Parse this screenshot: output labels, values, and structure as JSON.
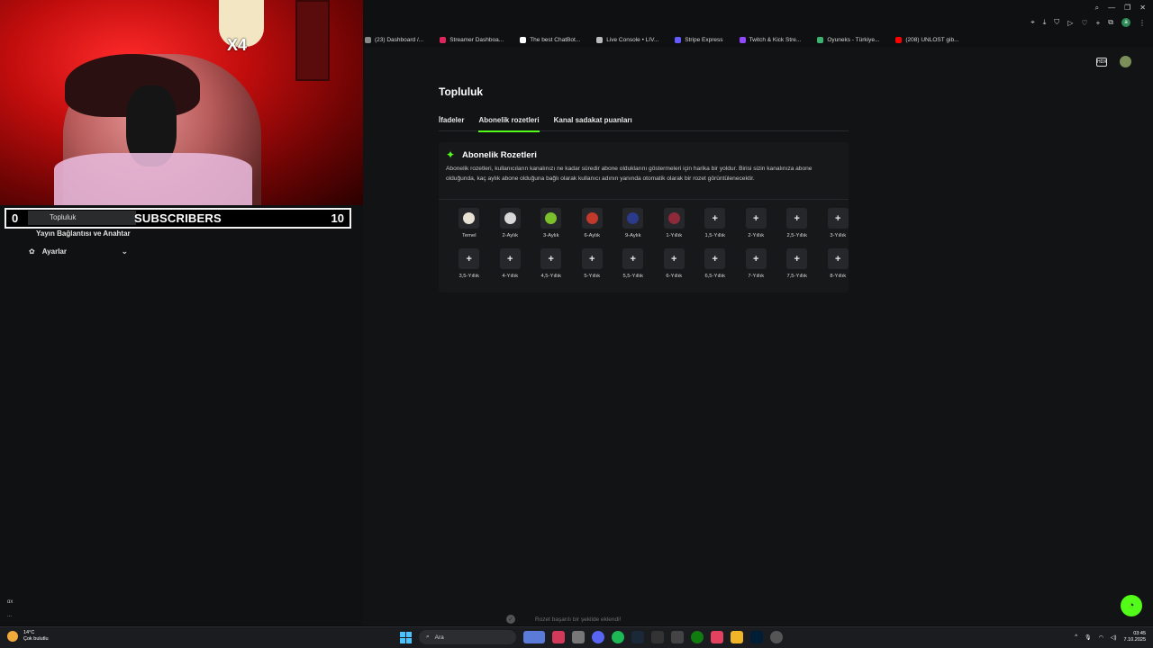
{
  "bookmarks": [
    {
      "label": "(23) Dashboard /...",
      "color": "#888888"
    },
    {
      "label": "Streamer Dashboa...",
      "color": "#e0245e"
    },
    {
      "label": "The best ChatBot...",
      "color": "#ffffff"
    },
    {
      "label": "Live Console • LIV...",
      "color": "#bbbbbb"
    },
    {
      "label": "Stripe Express",
      "color": "#635bff"
    },
    {
      "label": "Twitch & Kick Stre...",
      "color": "#9146ff"
    },
    {
      "label": "Oyuneks - Türkiye...",
      "color": "#3cb371"
    },
    {
      "label": "(208) UNLOST gib...",
      "color": "#ff0000"
    }
  ],
  "sidebar": {
    "stream_key_label": "Yayın Bağlantısı ve Anahtar",
    "settings_label": "Ayarlar",
    "bottom_1": "ɑx",
    "bottom_2": "..."
  },
  "overlay": {
    "chibi_text": "X4",
    "goal_start": "0",
    "goal_label": "SUBSCRIBERS",
    "goal_end": "10",
    "hidden_nav_item": "Topluluk"
  },
  "page": {
    "title": "Topluluk",
    "tabs": [
      {
        "label": "İfadeler",
        "active": false
      },
      {
        "label": "Abonelik rozetleri",
        "active": true
      },
      {
        "label": "Kanal sadakat puanları",
        "active": false
      }
    ]
  },
  "card": {
    "title": "Abonelik Rozetleri",
    "description": "Abonelik rozetleri, kullanıcıların kanalınızı ne kadar süredir abone olduklarını göstermeleri için harika bir yoldur. Birisi sizin kanalınıza abone olduğunda, kaç aylık abone olduğuna bağlı olarak kullanıcı adının yanında otomatik olarak bir rozet görüntülenecektir."
  },
  "badges": [
    {
      "label": "Temel",
      "icon": "badge-base",
      "color": "#e8e2d4"
    },
    {
      "label": "2-Aylık",
      "icon": "badge-2m",
      "color": "#d8d8d8"
    },
    {
      "label": "3-Aylık",
      "icon": "badge-3m",
      "color": "#7bbf2a"
    },
    {
      "label": "6-Aylık",
      "icon": "badge-6m",
      "color": "#c0392b"
    },
    {
      "label": "9-Aylık",
      "icon": "badge-9m",
      "color": "#2b3a8a"
    },
    {
      "label": "1-Yıllık",
      "icon": "badge-1y",
      "color": "#8e2a3a"
    },
    {
      "label": "1,5-Yıllık",
      "icon": "plus",
      "color": ""
    },
    {
      "label": "2-Yıllık",
      "icon": "plus",
      "color": ""
    },
    {
      "label": "2,5-Yıllık",
      "icon": "plus",
      "color": ""
    },
    {
      "label": "3-Yıllık",
      "icon": "plus",
      "color": ""
    },
    {
      "label": "3,5-Yıllık",
      "icon": "plus",
      "color": ""
    },
    {
      "label": "4-Yıllık",
      "icon": "plus",
      "color": ""
    },
    {
      "label": "4,5-Yıllık",
      "icon": "plus",
      "color": ""
    },
    {
      "label": "5-Yıllık",
      "icon": "plus",
      "color": ""
    },
    {
      "label": "5,5-Yıllık",
      "icon": "plus",
      "color": ""
    },
    {
      "label": "6-Yıllık",
      "icon": "plus",
      "color": ""
    },
    {
      "label": "6,5-Yıllık",
      "icon": "plus",
      "color": ""
    },
    {
      "label": "7-Yıllık",
      "icon": "plus",
      "color": ""
    },
    {
      "label": "7,5-Yıllık",
      "icon": "plus",
      "color": ""
    },
    {
      "label": "8-Yıllık",
      "icon": "plus",
      "color": ""
    }
  ],
  "plus_glyph": "+",
  "toast": {
    "text": "Rozet başarılı bir şekilde eklendi!"
  },
  "taskbar": {
    "temperature": "14°C",
    "weather": "Çok bulutlu",
    "search_placeholder": "Ara",
    "time": "03:45",
    "date": "7.10.2025"
  },
  "accent_color": "#53fc18"
}
